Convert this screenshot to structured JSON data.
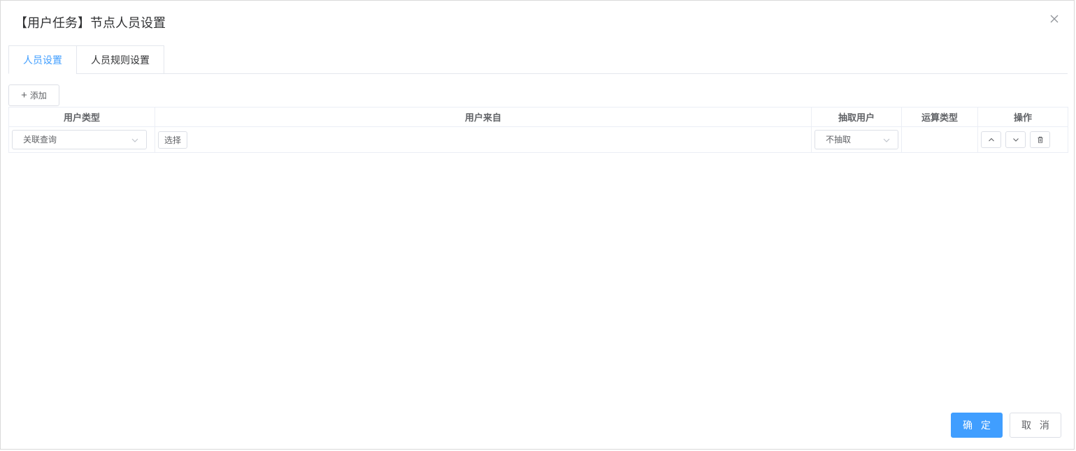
{
  "dialog": {
    "title": "【用户任务】节点人员设置"
  },
  "tabs": [
    {
      "label": "人员设置",
      "active": true
    },
    {
      "label": "人员规则设置",
      "active": false
    }
  ],
  "toolbar": {
    "add_label": "添加"
  },
  "table": {
    "columns": [
      "用户类型",
      "用户来自",
      "抽取用户",
      "运算类型",
      "操作"
    ],
    "rows": [
      {
        "user_type": "关联查询",
        "choose_label": "选择",
        "extract": "不抽取",
        "operation_type": ""
      }
    ]
  },
  "footer": {
    "confirm_label": "确 定",
    "cancel_label": "取 消"
  },
  "colors": {
    "primary": "#409eff",
    "border": "#dcdfe6",
    "text": "#606266"
  },
  "icons": {
    "close": "close-icon",
    "plus": "plus-icon",
    "select_arrow": "chevron-down-icon",
    "move_up": "chevron-up-icon",
    "move_down": "chevron-down-icon",
    "delete": "trash-icon"
  }
}
